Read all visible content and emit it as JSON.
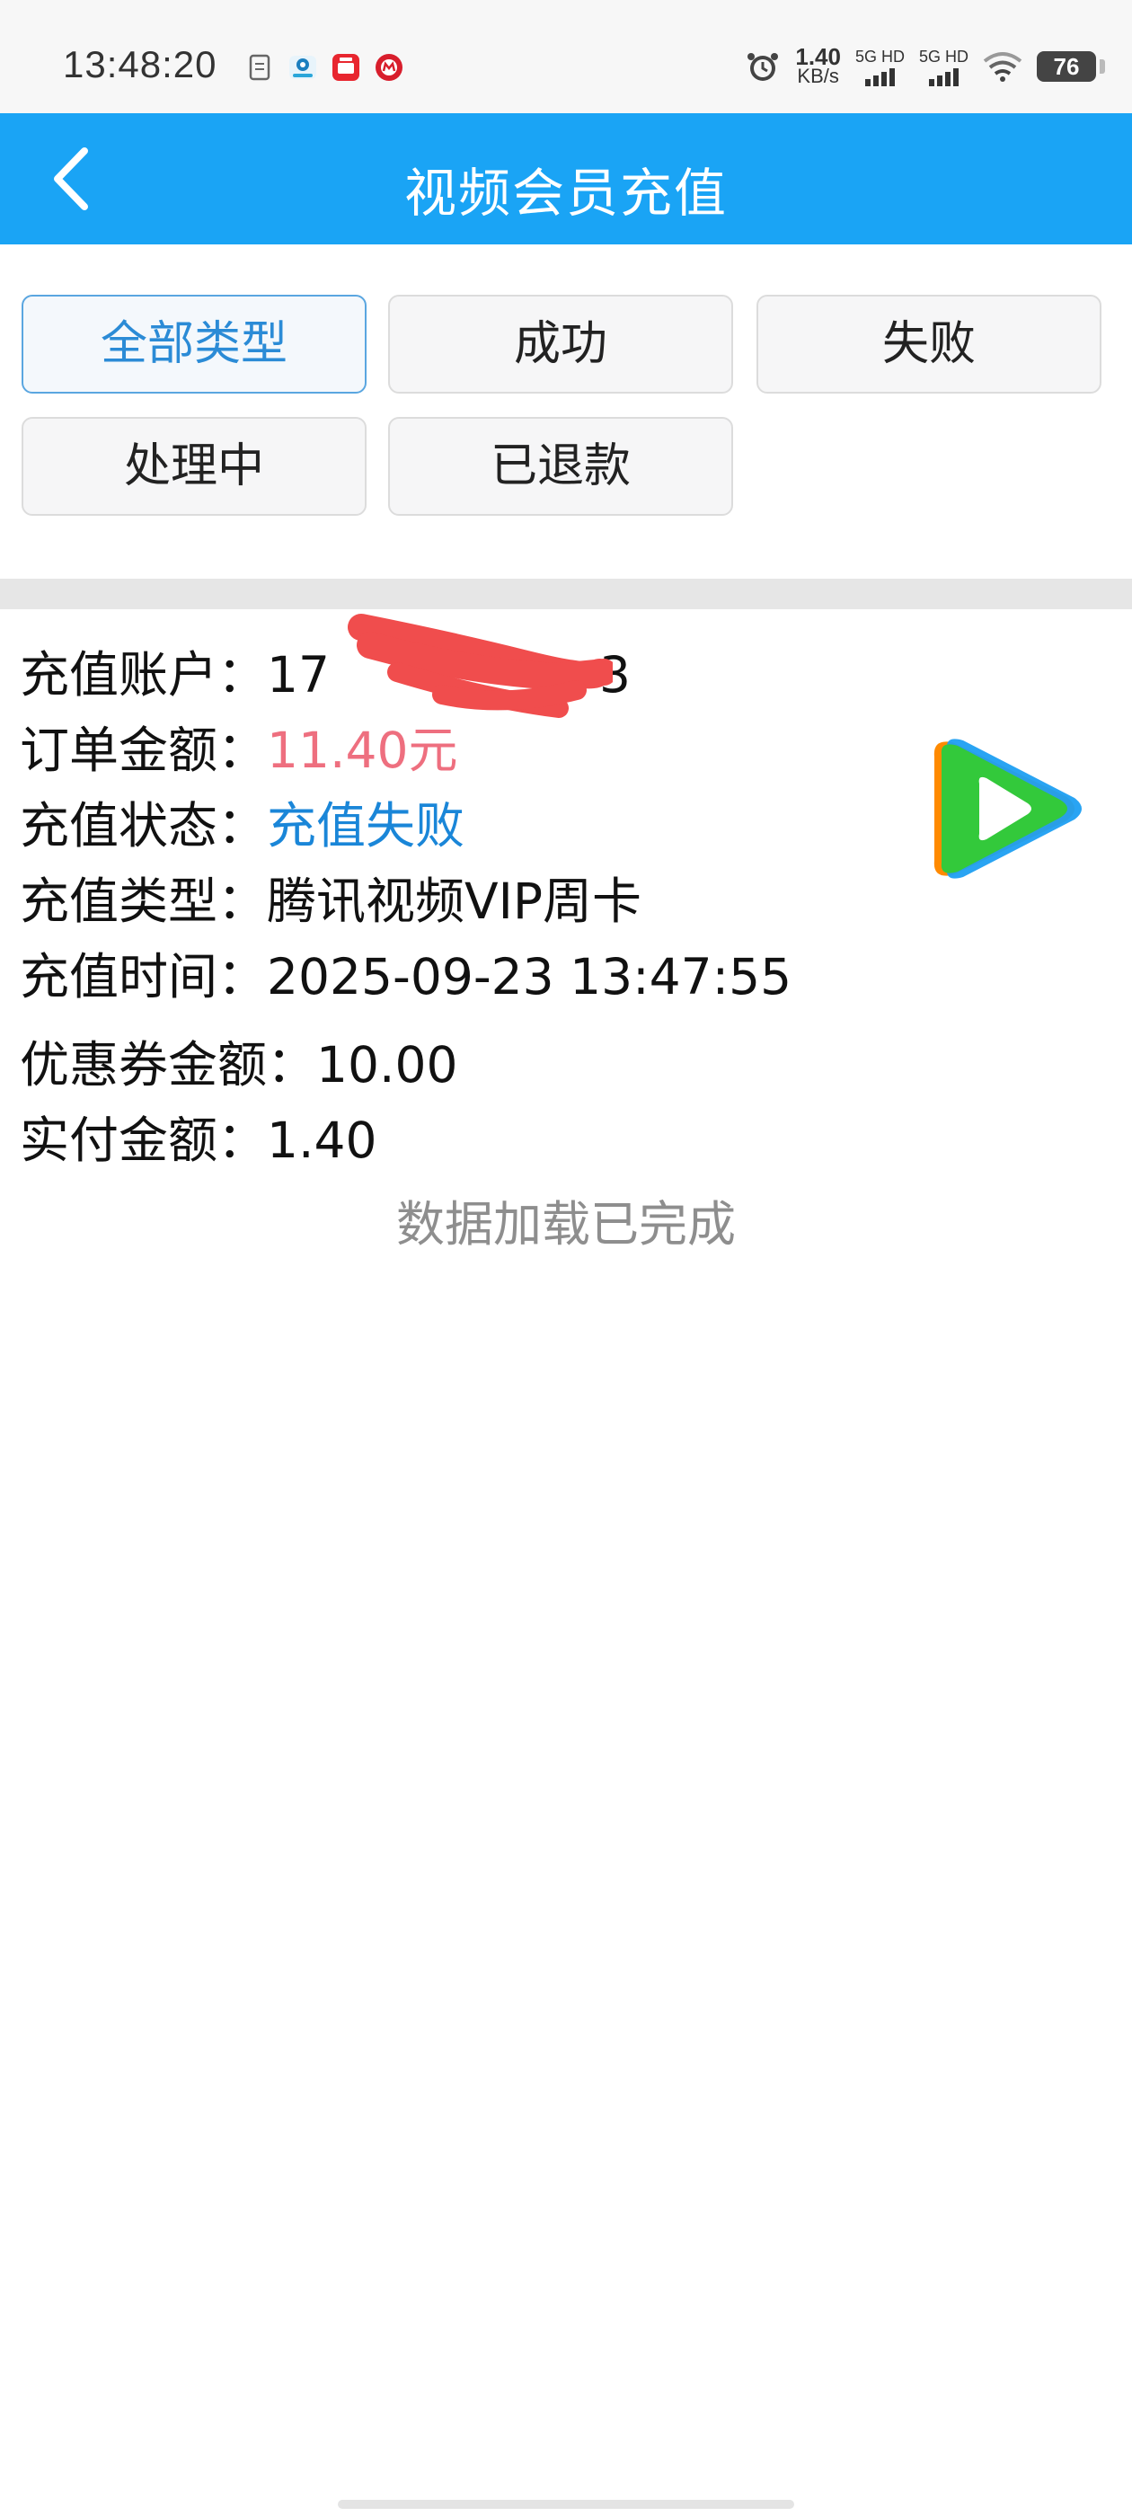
{
  "status_bar": {
    "time": "13:48:20",
    "net_speed_value": "1.40",
    "net_speed_unit": "KB/s",
    "sim1_label": "5G HD",
    "sim2_label": "5G HD",
    "battery": "76"
  },
  "header": {
    "title": "视频会员充值"
  },
  "filters": {
    "items": [
      {
        "label": "全部类型",
        "active": true
      },
      {
        "label": "成功"
      },
      {
        "label": "失败"
      },
      {
        "label": "处理中"
      },
      {
        "label": "已退款"
      }
    ]
  },
  "order": {
    "account_label": "充值账户：",
    "account_value": "17",
    "account_value_tail": "3",
    "amount_label": "订单金额：",
    "amount_value": "11.40元",
    "status_label": "充值状态：",
    "status_value": "充值失败",
    "type_label": "充值类型：",
    "type_value": "腾讯视频VIP周卡",
    "time_label": "充值时间：",
    "time_value": "2025-09-23 13:47:55",
    "coupon_label": "优惠券金额：",
    "coupon_value": "10.00",
    "paid_label": "实付金额：",
    "paid_value": "1.40"
  },
  "footer": {
    "load_status": "数据加载已完成"
  },
  "colors": {
    "header": "#1aa4f5",
    "amount": "#ee6f7f",
    "status": "#1a86d8",
    "redaction": "#f04d4d"
  },
  "icons": {
    "back": "chevron-left-icon",
    "app_logo": "tencent-video-logo-icon",
    "alarm": "alarm-icon",
    "wifi": "wifi-icon"
  }
}
